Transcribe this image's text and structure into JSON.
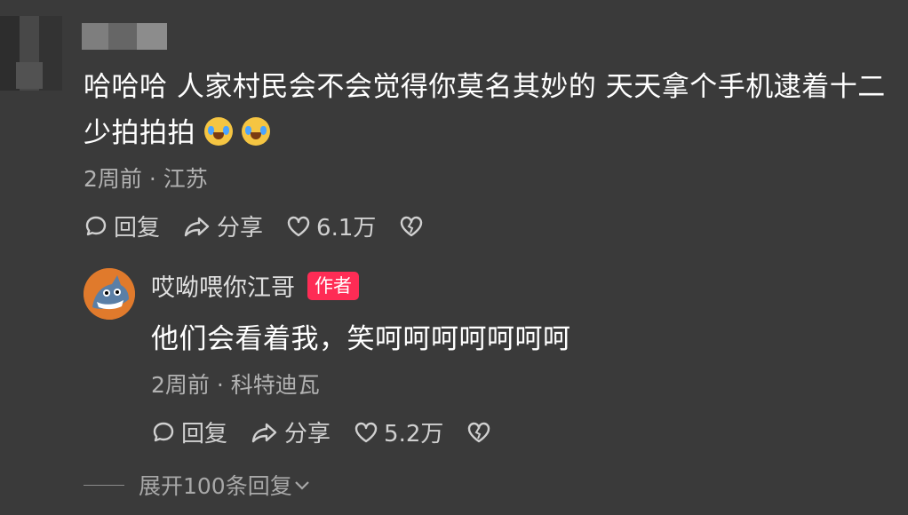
{
  "comment": {
    "text": "哈哈哈 人家村民会不会觉得你莫名其妙的 天天拿个手机逮着十二少拍拍拍",
    "emojis": [
      "cry-laugh-emoji",
      "cry-laugh-emoji"
    ],
    "time": "2周前",
    "location": "江苏",
    "reply_label": "回复",
    "share_label": "分享",
    "likes": "6.1万"
  },
  "reply": {
    "username": "哎呦喂你江哥",
    "badge": "作者",
    "text": "他们会看着我，笑呵呵呵呵呵呵呵",
    "time": "2周前",
    "location": "科特迪瓦",
    "reply_label": "回复",
    "share_label": "分享",
    "likes": "5.2万"
  },
  "expand": {
    "label": "展开100条回复"
  },
  "separator": "·",
  "colors": {
    "background": "#3a3a3a",
    "author_badge": "#fe2c55",
    "meta_text": "#b2b2b2"
  }
}
